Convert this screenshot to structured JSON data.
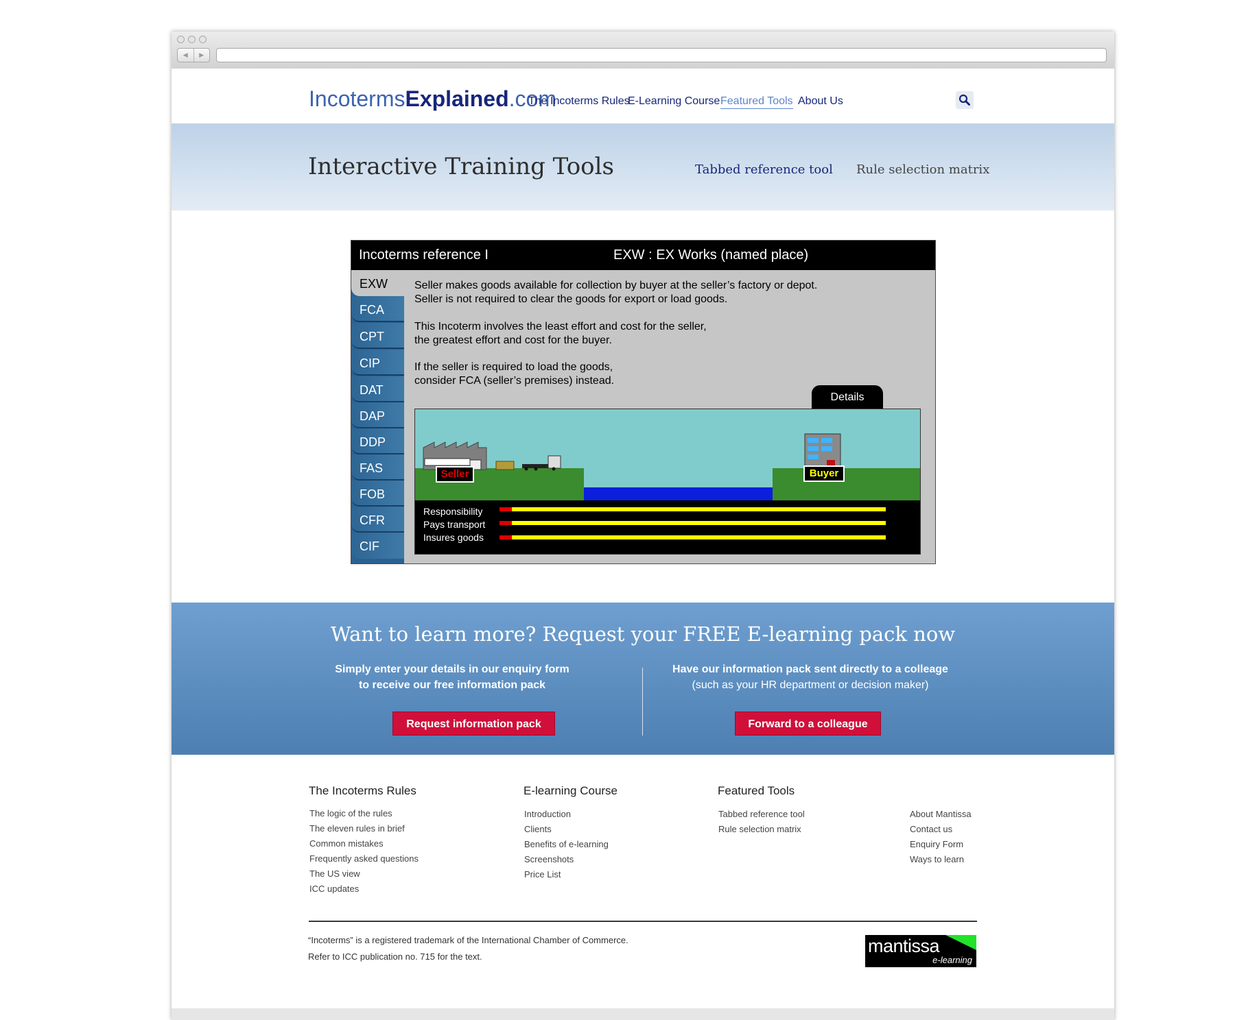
{
  "site": {
    "logo_part1": "Incoterms",
    "logo_part2": "Explained",
    "logo_part3": ".com",
    "nav": [
      "The Incoterms Rules",
      "E-Learning Course",
      "Featured Tools",
      "About Us"
    ],
    "active_nav": "Featured Tools",
    "search_icon": "search-icon"
  },
  "hero": {
    "title": "Interactive Training Tools",
    "link1": "Tabbed reference tool",
    "link2": "Rule selection matrix"
  },
  "tool": {
    "header_left": "Incoterms reference I",
    "header_right": "EXW : EX Works (named place)",
    "tabs": [
      "EXW",
      "FCA",
      "CPT",
      "CIP",
      "DAT",
      "DAP",
      "DDP",
      "FAS",
      "FOB",
      "CFR",
      "CIF"
    ],
    "selected_tab": "EXW",
    "description": [
      "Seller makes goods available for collection by buyer at the seller’s factory or depot.",
      "Seller is not required to clear the goods for export or load goods.",
      "This Incoterm involves the least effort and cost for the seller,",
      "the greatest effort and cost for the buyer.",
      "If the seller is required to load the goods,",
      "consider FCA (seller’s premises) instead."
    ],
    "details_label": "Details",
    "seller_label": "Seller",
    "buyer_label": "Buyer",
    "bar_labels": [
      "Responsibility",
      "Pays transport",
      "Insures goods"
    ],
    "colors": {
      "seller_share": "#e00000",
      "buyer_share": "#ffff00",
      "sky": "#80cccc",
      "ground": "#3a8c2e",
      "sea": "#0c1fdc"
    }
  },
  "cta": {
    "title": "Want to learn more? Request your FREE E-learning pack now",
    "left_line1": "Simply enter your details in our enquiry form",
    "left_line2": "to receive our free information pack",
    "right_line1": "Have our information pack sent directly to a colleage",
    "right_line2": "(such as your HR department or decision maker)",
    "button_left": "Request information pack",
    "button_right": "Forward to a colleague",
    "accent": "#d0103a"
  },
  "footer": {
    "columns": [
      {
        "heading": "The Incoterms Rules",
        "links": [
          "The logic of the rules",
          "The eleven rules in brief",
          "Common mistakes",
          "Frequently asked questions",
          "The US view",
          "ICC updates"
        ]
      },
      {
        "heading": "E-learning Course",
        "links": [
          "Introduction",
          "Clients",
          "Benefits of e-learning",
          "Screenshots",
          "Price List"
        ]
      },
      {
        "heading": "Featured Tools",
        "links": [
          "Tabbed reference tool",
          "Rule selection matrix"
        ]
      },
      {
        "heading": "",
        "links": [
          "About Mantissa",
          "Contact us",
          "Enquiry Form",
          "Ways to learn"
        ]
      }
    ],
    "legal_line1": "“Incoterms” is a registered trademark of the International Chamber of Commerce.",
    "legal_line2": "Refer to ICC publication no. 715 for the text.",
    "brand_name": "mantissa",
    "brand_sub": "e-learning"
  }
}
